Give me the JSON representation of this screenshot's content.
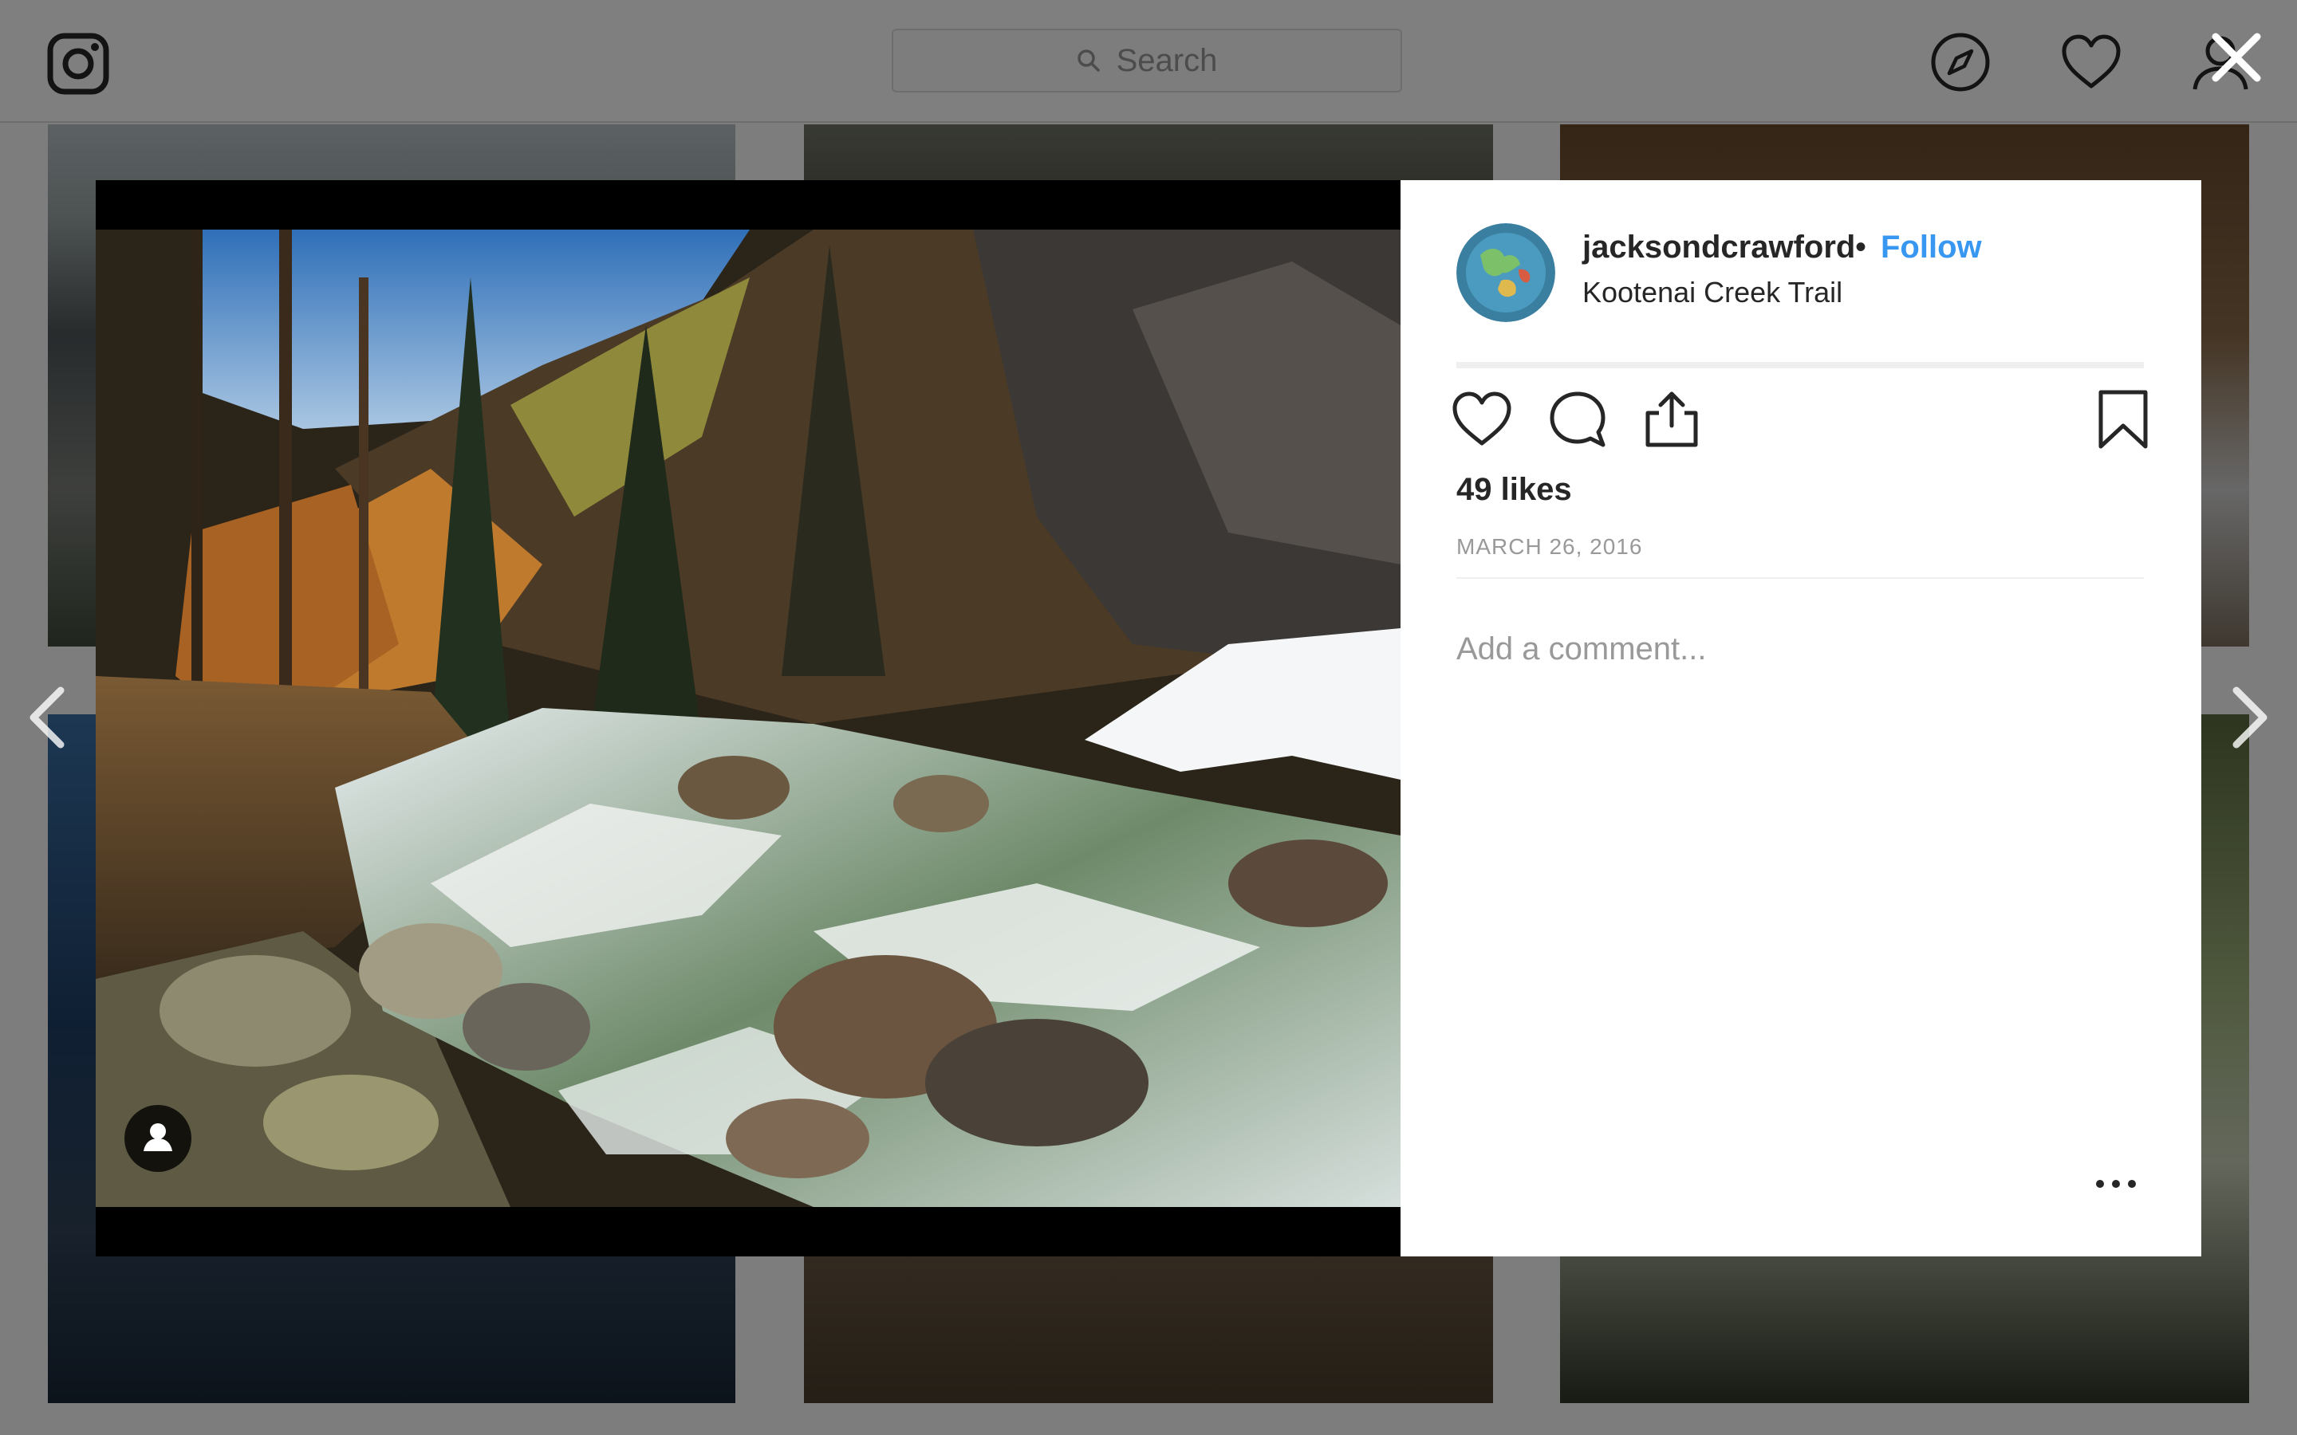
{
  "topbar": {
    "logo_icon": "instagram-icon",
    "search_placeholder": "Search",
    "nav_icons": [
      "compass-icon",
      "heart-icon",
      "user-icon"
    ]
  },
  "overlay": {
    "close_icon": "close-icon",
    "prev_icon": "chevron-left-icon",
    "next_icon": "chevron-right-icon"
  },
  "post": {
    "photo_icon": "tag-person-icon",
    "username": "jacksondcrawford",
    "separator": "•",
    "follow_label": "Follow",
    "location": "Kootenai Creek Trail",
    "actions": [
      "heart-icon",
      "comment-icon",
      "share-icon",
      "bookmark-icon"
    ],
    "likes": "49 likes",
    "date": "MARCH 26, 2016",
    "comment_placeholder": "Add a comment...",
    "more_icon": "more-options-icon"
  },
  "colors": {
    "link_blue": "#3897f0",
    "text_dark": "#262626",
    "text_muted": "#999999",
    "overlay": "rgba(0,0,0,0.5)"
  }
}
